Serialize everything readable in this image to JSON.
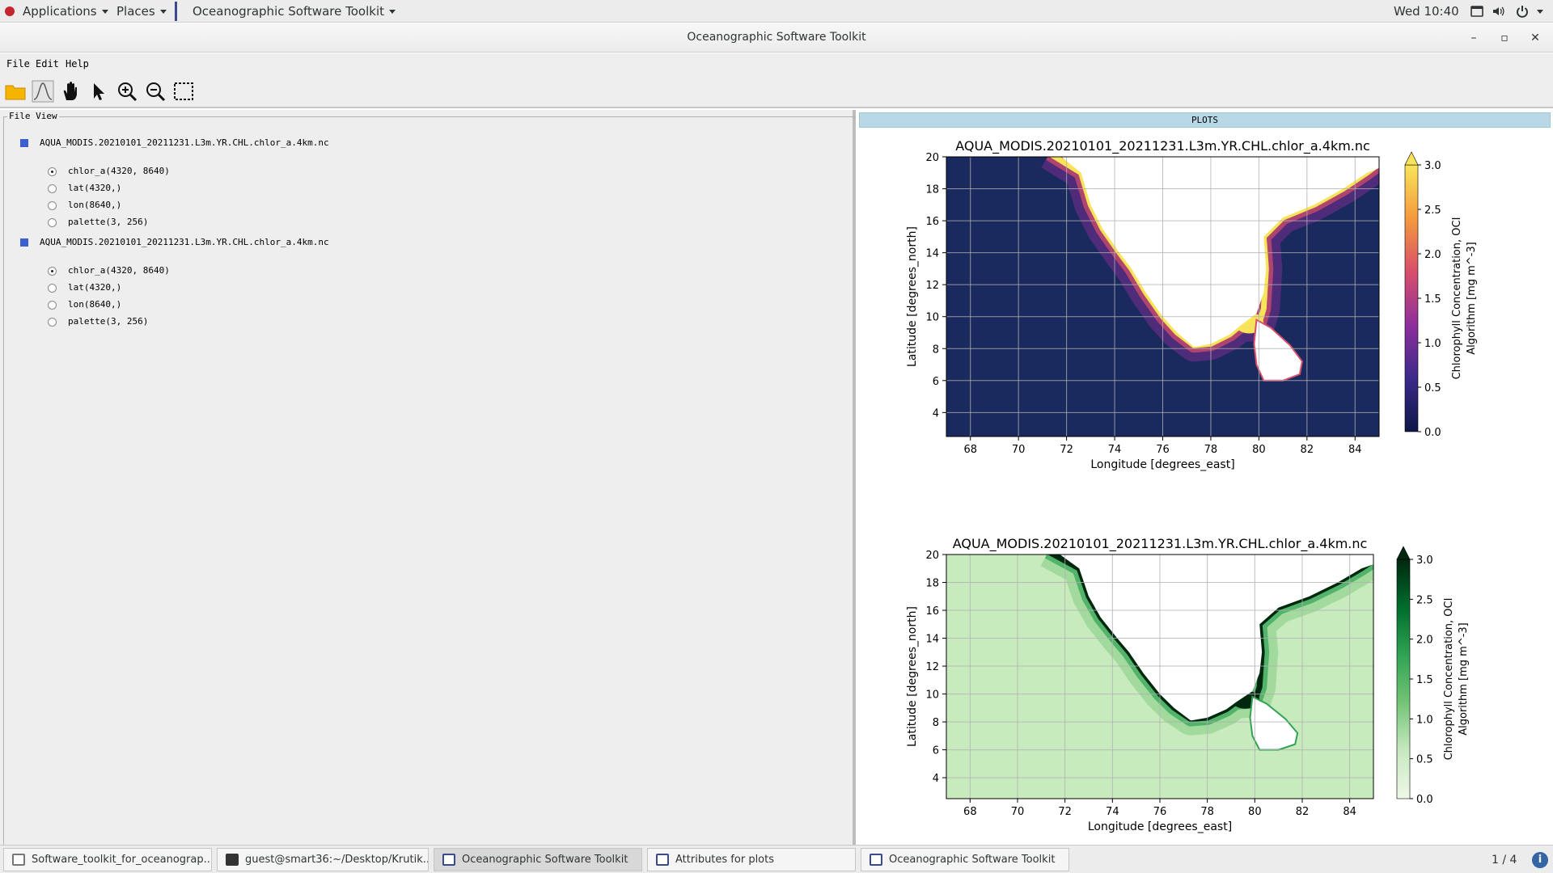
{
  "topbar": {
    "applications": "Applications",
    "places": "Places",
    "app_menu": "Oceanographic Software Toolkit",
    "clock": "Wed 10:40"
  },
  "window": {
    "title": "Oceanographic Software Toolkit",
    "minimize": "–",
    "maximize": "▫",
    "close": "✕"
  },
  "menubar": {
    "file": "File",
    "edit": "Edit",
    "help": "Help"
  },
  "toolbar": {
    "tools": [
      "folder-icon",
      "curve-icon",
      "hand-pan-icon",
      "pointer-icon",
      "zoom-in-icon",
      "zoom-out-icon",
      "select-rect-icon"
    ]
  },
  "file_view": {
    "label": "File View",
    "files": [
      {
        "name": "AQUA_MODIS.20210101_20211231.L3m.YR.CHL.chlor_a.4km.nc",
        "variables": [
          "chlor_a(4320, 8640)",
          "lat(4320,)",
          "lon(8640,)",
          "palette(3, 256)"
        ],
        "selected": 0
      },
      {
        "name": "AQUA_MODIS.20210101_20211231.L3m.YR.CHL.chlor_a.4km.nc",
        "variables": [
          "chlor_a(4320, 8640)",
          "lat(4320,)",
          "lon(8640,)",
          "palette(3, 256)"
        ],
        "selected": 0
      }
    ]
  },
  "plots_header": "PLOTS",
  "chart_data": [
    {
      "type": "heatmap",
      "title": "AQUA_MODIS.20210101_20211231.L3m.YR.CHL.chlor_a.4km.nc",
      "xlabel": "Longitude [degrees_east]",
      "ylabel": "Latitude [degrees_north]",
      "xticks": [
        68,
        70,
        72,
        74,
        76,
        78,
        80,
        82,
        84
      ],
      "yticks": [
        4,
        6,
        8,
        10,
        12,
        14,
        16,
        18,
        20
      ],
      "xlim": [
        67,
        85
      ],
      "ylim": [
        2.5,
        20
      ],
      "grid": true,
      "colorbar": {
        "label_line1": "Chlorophyll Concentration, OCI",
        "label_line2": "Algorithm [mg m^-3]",
        "ticks": [
          "0.0",
          "0.5",
          "1.0",
          "1.5",
          "2.0",
          "2.5",
          "3.0"
        ],
        "range": [
          0,
          3
        ],
        "colormap": "plasma-like",
        "colors": [
          "#0d1747",
          "#3b2a8a",
          "#8e2f9c",
          "#d84f6b",
          "#f49a3d",
          "#f8e45a"
        ]
      },
      "ocean_color": "#1a2a5e",
      "land_color": "#ffffff"
    },
    {
      "type": "heatmap",
      "title": "AQUA_MODIS.20210101_20211231.L3m.YR.CHL.chlor_a.4km.nc",
      "xlabel": "Longitude [degrees_east]",
      "ylabel": "Latitude [degrees_north]",
      "xticks": [
        68,
        70,
        72,
        74,
        76,
        78,
        80,
        82,
        84
      ],
      "yticks": [
        4,
        6,
        8,
        10,
        12,
        14,
        16,
        18,
        20
      ],
      "xlim": [
        67,
        85
      ],
      "ylim": [
        2.5,
        20
      ],
      "grid": true,
      "colorbar": {
        "label_line1": "Chlorophyll Concentration, OCI",
        "label_line2": "Algorithm [mg m^-3]",
        "ticks": [
          "0.0",
          "0.5",
          "1.0",
          "1.5",
          "2.0",
          "2.5",
          "3.0"
        ],
        "range": [
          0,
          3
        ],
        "colormap": "greens",
        "colors": [
          "#eef8e8",
          "#c7e9c0",
          "#74c476",
          "#31a354",
          "#006d2c",
          "#00280f"
        ]
      },
      "ocean_color": "#c8ebbd",
      "land_color": "#ffffff"
    }
  ],
  "taskbar": {
    "tasks": [
      "Software_toolkit_for_oceanograp...",
      "guest@smart36:~/Desktop/Krutik...",
      "Oceanographic Software Toolkit",
      "Attributes for plots",
      "Oceanographic Software Toolkit"
    ],
    "pager": "1 / 4",
    "info": "i"
  }
}
